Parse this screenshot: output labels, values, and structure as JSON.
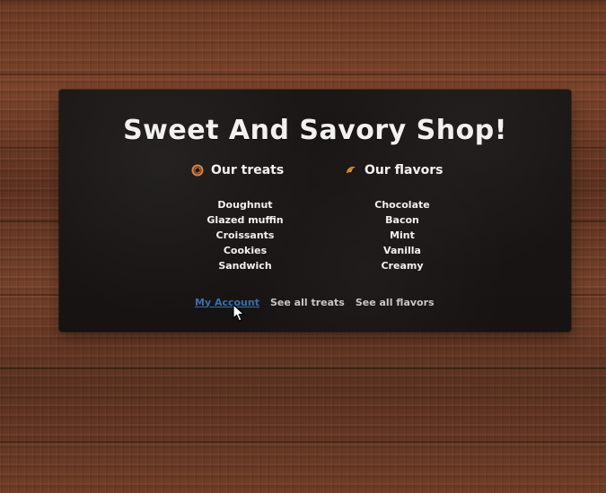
{
  "page": {
    "title": "Sweet And Savory Shop!"
  },
  "sections": {
    "treats": {
      "heading": "Our treats",
      "icon": "doughnut-icon",
      "items": [
        "Doughnut",
        "Glazed muffin",
        "Croissants",
        "Cookies",
        "Sandwich"
      ]
    },
    "flavors": {
      "heading": "Our flavors",
      "icon": "croissant-icon",
      "items": [
        "Chocolate",
        "Bacon",
        "Mint",
        "Vanilla",
        "Creamy"
      ]
    }
  },
  "footer": {
    "account": "My Account",
    "all_treats": "See all treats",
    "all_flavors": "See all flavors"
  },
  "colors": {
    "board_background": "#171413",
    "text_primary": "#f2f1ee",
    "link_active": "#3a6fa8",
    "link_muted": "#c8c7c4",
    "icon_orange": "#d99a33"
  },
  "cursor": {
    "icon": "mouse-pointer-icon"
  }
}
